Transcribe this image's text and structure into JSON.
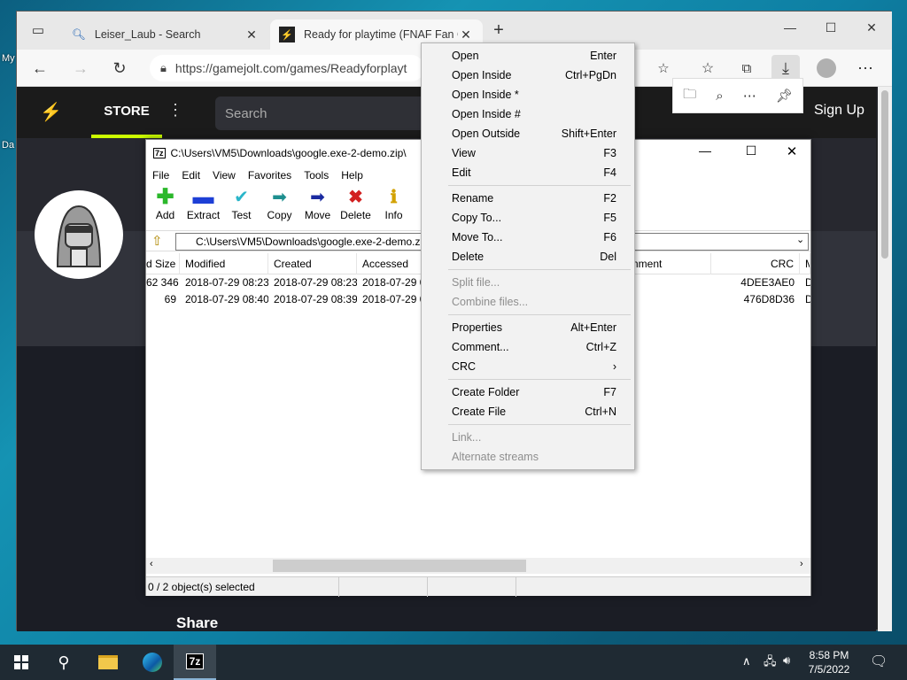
{
  "desktop": {
    "label_top": "My",
    "label_mid": "Da"
  },
  "browser": {
    "tabs": [
      {
        "title": "Leiser_Laub - Search",
        "icon": "search-icon"
      },
      {
        "title": "Ready for playtime (FNAF Fan Ga",
        "icon": "gamejolt-icon"
      }
    ],
    "url": "https://gamejolt.com/games/Readyforplayt",
    "site": {
      "store_label": "STORE",
      "search_placeholder": "Search",
      "signup_label": "Sign Up",
      "share_label": "Share"
    }
  },
  "zip": {
    "title": "C:\\Users\\VM5\\Downloads\\google.exe-2-demo.zip\\",
    "menu": [
      "File",
      "Edit",
      "View",
      "Favorites",
      "Tools",
      "Help"
    ],
    "tools": [
      {
        "label": "Add",
        "icon": "plus-icon",
        "color": "#2bb82b"
      },
      {
        "label": "Extract",
        "icon": "minus-icon",
        "color": "#1d3fd6"
      },
      {
        "label": "Test",
        "icon": "check-icon",
        "color": "#2ab5c9"
      },
      {
        "label": "Copy",
        "icon": "copy-arrow-icon",
        "color": "#1e8f8f"
      },
      {
        "label": "Move",
        "icon": "move-arrow-icon",
        "color": "#1a2aa0"
      },
      {
        "label": "Delete",
        "icon": "delete-x-icon",
        "color": "#d21f1f"
      },
      {
        "label": "Info",
        "icon": "info-icon",
        "color": "#d2a100"
      }
    ],
    "address": "C:\\Users\\VM5\\Downloads\\google.exe-2-demo.z",
    "columns": [
      "d Size",
      "Modified",
      "Created",
      "Accessed",
      "omment",
      "CRC",
      "M"
    ],
    "rows": [
      {
        "size": "62 346",
        "modified": "2018-07-29 08:23",
        "created": "2018-07-29 08:23",
        "accessed": "2018-07-29 0",
        "crc": "4DEE3AE0",
        "m": "D"
      },
      {
        "size": "69",
        "modified": "2018-07-29 08:40",
        "created": "2018-07-29 08:39",
        "accessed": "2018-07-29 0",
        "crc": "476D8D36",
        "m": "D"
      }
    ],
    "status": "0 / 2 object(s) selected"
  },
  "context_menu": {
    "groups": [
      [
        {
          "label": "Open",
          "shortcut": "Enter",
          "disabled": false
        },
        {
          "label": "Open Inside",
          "shortcut": "Ctrl+PgDn",
          "disabled": false
        },
        {
          "label": "Open Inside *",
          "shortcut": "",
          "disabled": false
        },
        {
          "label": "Open Inside #",
          "shortcut": "",
          "disabled": false
        },
        {
          "label": "Open Outside",
          "shortcut": "Shift+Enter",
          "disabled": false
        },
        {
          "label": "View",
          "shortcut": "F3",
          "disabled": false
        },
        {
          "label": "Edit",
          "shortcut": "F4",
          "disabled": false
        }
      ],
      [
        {
          "label": "Rename",
          "shortcut": "F2",
          "disabled": false
        },
        {
          "label": "Copy To...",
          "shortcut": "F5",
          "disabled": false
        },
        {
          "label": "Move To...",
          "shortcut": "F6",
          "disabled": false
        },
        {
          "label": "Delete",
          "shortcut": "Del",
          "disabled": false
        }
      ],
      [
        {
          "label": "Split file...",
          "shortcut": "",
          "disabled": true
        },
        {
          "label": "Combine files...",
          "shortcut": "",
          "disabled": true
        }
      ],
      [
        {
          "label": "Properties",
          "shortcut": "Alt+Enter",
          "disabled": false
        },
        {
          "label": "Comment...",
          "shortcut": "Ctrl+Z",
          "disabled": false
        },
        {
          "label": "CRC",
          "shortcut": "›",
          "disabled": false
        }
      ],
      [
        {
          "label": "Create Folder",
          "shortcut": "F7",
          "disabled": false
        },
        {
          "label": "Create File",
          "shortcut": "Ctrl+N",
          "disabled": false
        }
      ],
      [
        {
          "label": "Link...",
          "shortcut": "",
          "disabled": true
        },
        {
          "label": "Alternate streams",
          "shortcut": "",
          "disabled": true
        }
      ]
    ]
  },
  "taskbar": {
    "time": "8:58 PM",
    "date": "7/5/2022",
    "zip_label": "7z"
  },
  "colors": {
    "accent": "#ccff00",
    "taskbar": "#1f2a33"
  }
}
